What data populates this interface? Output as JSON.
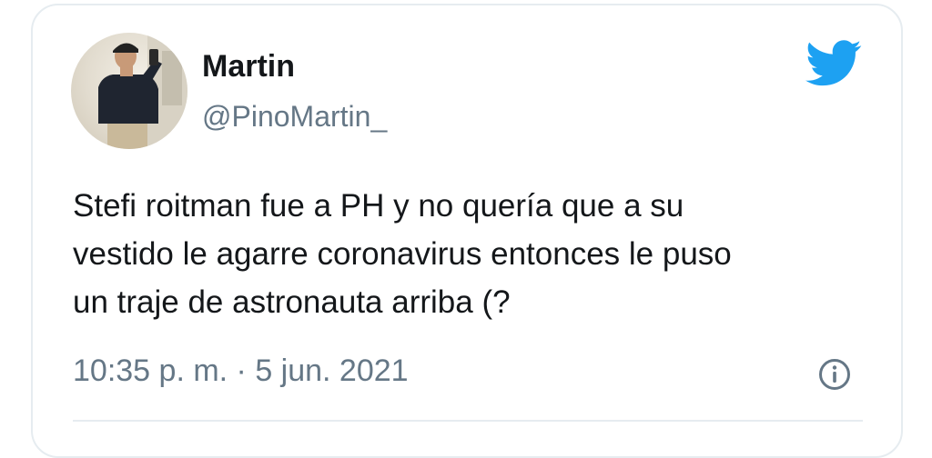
{
  "tweet": {
    "author_name": "Martin",
    "author_handle": "@PinoMartin_",
    "text": "Stefi roitman fue a PH y no quería que a su\nvestido le agarre coronavirus entonces le puso\nun traje de astronauta arriba (?",
    "timestamp": "10:35 p. m. · 5 jun. 2021"
  },
  "icons": {
    "brand": "twitter-bird-icon",
    "info": "info-icon"
  },
  "colors": {
    "brand": "#1da1f2",
    "primary_text": "#14171a",
    "secondary_text": "#657786",
    "border": "#e6ecf0"
  }
}
